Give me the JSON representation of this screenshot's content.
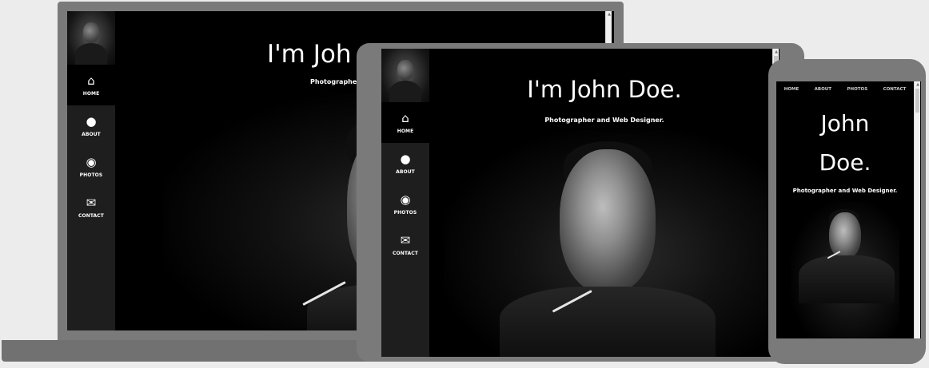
{
  "site": {
    "title": "I'm John Doe.",
    "title_laptop": "I'm Joh",
    "title_phone_line1": "John",
    "title_phone_line2": "Doe.",
    "subtitle": "Photographer and Web Designer.",
    "subtitle_laptop": "Photographer a"
  },
  "nav": {
    "items": [
      {
        "label": "HOME",
        "icon": "home-icon",
        "glyph": "⌂"
      },
      {
        "label": "ABOUT",
        "icon": "user-icon",
        "glyph": "●"
      },
      {
        "label": "PHOTOS",
        "icon": "eye-icon",
        "glyph": "◉"
      },
      {
        "label": "CONTACT",
        "icon": "envelope-icon",
        "glyph": "✉"
      }
    ]
  },
  "scroll": {
    "up": "▲",
    "down": "▼"
  },
  "colors": {
    "background": "#ececec",
    "device": "#7a7a7a",
    "sidebar": "#1e1e1e",
    "screen": "#000000",
    "text": "#ffffff"
  }
}
